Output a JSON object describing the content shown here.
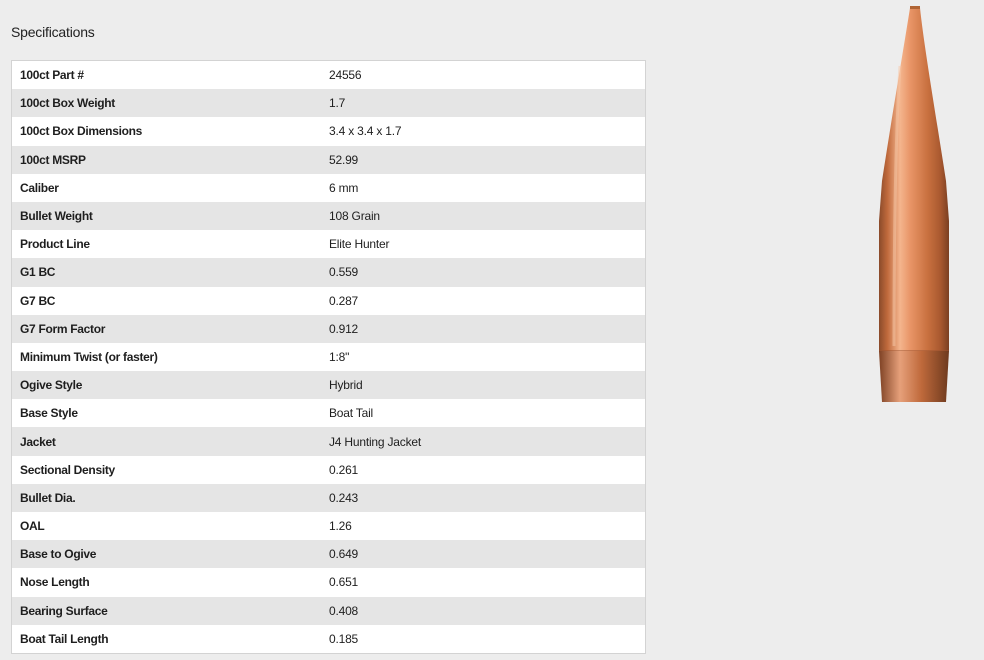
{
  "title": "Specifications",
  "specs": [
    {
      "label": "100ct Part #",
      "value": "24556"
    },
    {
      "label": "100ct Box Weight",
      "value": "1.7"
    },
    {
      "label": "100ct Box Dimensions",
      "value": "3.4 x 3.4 x 1.7"
    },
    {
      "label": "100ct MSRP",
      "value": "52.99"
    },
    {
      "label": "Caliber",
      "value": "6 mm"
    },
    {
      "label": "Bullet Weight",
      "value": "108 Grain"
    },
    {
      "label": "Product Line",
      "value": "Elite Hunter"
    },
    {
      "label": "G1 BC",
      "value": "0.559"
    },
    {
      "label": "G7 BC",
      "value": "0.287"
    },
    {
      "label": "G7 Form Factor",
      "value": "0.912"
    },
    {
      "label": "Minimum Twist (or faster)",
      "value": "1:8\""
    },
    {
      "label": "Ogive Style",
      "value": "Hybrid"
    },
    {
      "label": "Base Style",
      "value": "Boat Tail"
    },
    {
      "label": "Jacket",
      "value": "J4 Hunting Jacket"
    },
    {
      "label": "Sectional Density",
      "value": "0.261"
    },
    {
      "label": "Bullet Dia.",
      "value": "0.243"
    },
    {
      "label": "OAL",
      "value": "1.26"
    },
    {
      "label": "Base to Ogive",
      "value": "0.649"
    },
    {
      "label": "Nose Length",
      "value": "0.651"
    },
    {
      "label": "Bearing Surface",
      "value": "0.408"
    },
    {
      "label": "Boat Tail Length",
      "value": "0.185"
    }
  ],
  "colors": {
    "background": "#ededed",
    "row_alt": "#e5e5e5",
    "row": "#ffffff",
    "border": "#d3d3d3",
    "bullet_light": "#f4b58e",
    "bullet_mid": "#d27a4a",
    "bullet_dark": "#8a4a2a"
  },
  "image": {
    "icon": "bullet-image"
  }
}
